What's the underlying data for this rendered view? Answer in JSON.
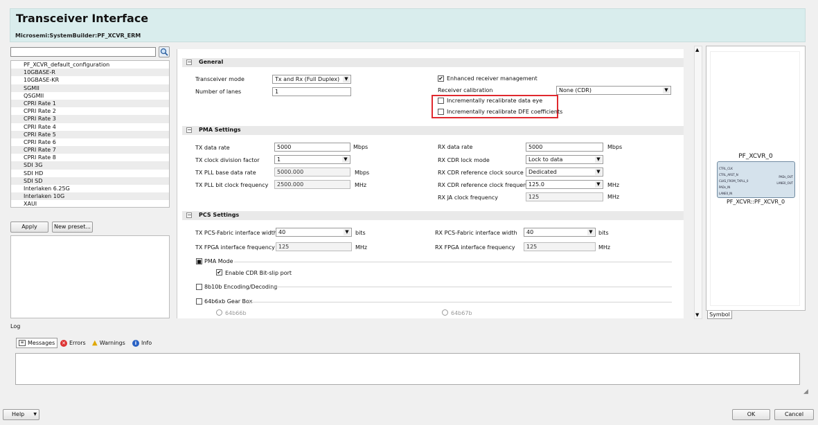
{
  "header": {
    "title": "Transceiver Interface",
    "subtitle": "Microsemi:SystemBuilder:PF_XCVR_ERM"
  },
  "search": {
    "value": "",
    "icon": "magnifier-icon"
  },
  "presets": [
    "PF_XCVR_default_configuration",
    "10GBASE-R",
    "10GBASE-KR",
    "SGMII",
    "QSGMII",
    "CPRI Rate 1",
    "CPRI Rate 2",
    "CPRI Rate 3",
    "CPRI Rate 4",
    "CPRI Rate 5",
    "CPRI Rate 6",
    "CPRI Rate 7",
    "CPRI Rate 8",
    "SDI 3G",
    "SDI HD",
    "SDI SD",
    "Interlaken 6.25G",
    "Interlaken 10G",
    "XAUI"
  ],
  "preset_buttons": {
    "apply": "Apply",
    "new_preset": "New preset..."
  },
  "general": {
    "title": "General",
    "transceiver_mode_label": "Transceiver mode",
    "transceiver_mode": "Tx and Rx (Full Duplex)",
    "lanes_label": "Number of lanes",
    "lanes": "1",
    "enhanced_label": "Enhanced receiver management",
    "enhanced_checked": true,
    "rx_cal_label": "Receiver calibration",
    "rx_cal": "None (CDR)",
    "recal_eye_label": "Incrementally recalibrate data eye",
    "recal_dfe_label": "Incrementally recalibrate DFE coefficients",
    "highlight_color": "#e0282e"
  },
  "pma": {
    "title": "PMA Settings",
    "tx_rate_label": "TX data rate",
    "tx_rate": "5000",
    "tx_rate_unit": "Mbps",
    "tx_div_label": "TX clock division factor",
    "tx_div": "1",
    "tx_pll_base_label": "TX PLL base data rate",
    "tx_pll_base": "5000.000",
    "tx_pll_base_unit": "Mbps",
    "tx_pll_bit_label": "TX PLL bit clock frequency",
    "tx_pll_bit": "2500.000",
    "tx_pll_bit_unit": "MHz",
    "rx_rate_label": "RX data rate",
    "rx_rate": "5000",
    "rx_rate_unit": "Mbps",
    "rx_cdr_lock_label": "RX CDR lock mode",
    "rx_cdr_lock": "Lock to data",
    "rx_cdr_src_label": "RX CDR reference clock source",
    "rx_cdr_src": "Dedicated",
    "rx_cdr_freq_label": "RX CDR reference clock frequency",
    "rx_cdr_freq": "125.0",
    "rx_cdr_freq_unit": "MHz",
    "rx_ja_label": "RX JA clock frequency",
    "rx_ja": "125",
    "rx_ja_unit": "MHz"
  },
  "pcs": {
    "title": "PCS Settings",
    "tx_width_label": "TX PCS-Fabric interface width",
    "tx_width": "40",
    "tx_width_unit": "bits",
    "tx_fpga_label": "TX FPGA interface frequency",
    "tx_fpga": "125",
    "tx_fpga_unit": "MHz",
    "rx_width_label": "RX PCS-Fabric interface width",
    "rx_width": "40",
    "rx_width_unit": "bits",
    "rx_fpga_label": "RX FPGA interface frequency",
    "rx_fpga": "125",
    "rx_fpga_unit": "MHz",
    "pma_mode_label": "PMA Mode",
    "cdr_bitslip_label": "Enable CDR Bit-slip port",
    "enc8b10b_label": "8b10b Encoding/Decoding",
    "gearbox_label": "64b6xb Gear Box",
    "opt66_label": "64b66b",
    "opt67_label": "64b67b"
  },
  "symbol": {
    "title": "PF_XCVR_0",
    "caption": "PF_XCVR::PF_XCVR_0",
    "tab": "Symbol",
    "ports_left": [
      "CTRL_CLK",
      "CTRL_ARST_N",
      "CLKS_FROM_TXPLL_0",
      "PADs_IN",
      "LANE0_IN"
    ],
    "ports_right": [
      "PADs_OUT",
      "LANE0_OUT"
    ]
  },
  "log": {
    "title": "Log",
    "tabs": [
      "Messages",
      "Errors",
      "Warnings",
      "Info"
    ]
  },
  "footer": {
    "help": "Help",
    "ok": "OK",
    "cancel": "Cancel"
  }
}
